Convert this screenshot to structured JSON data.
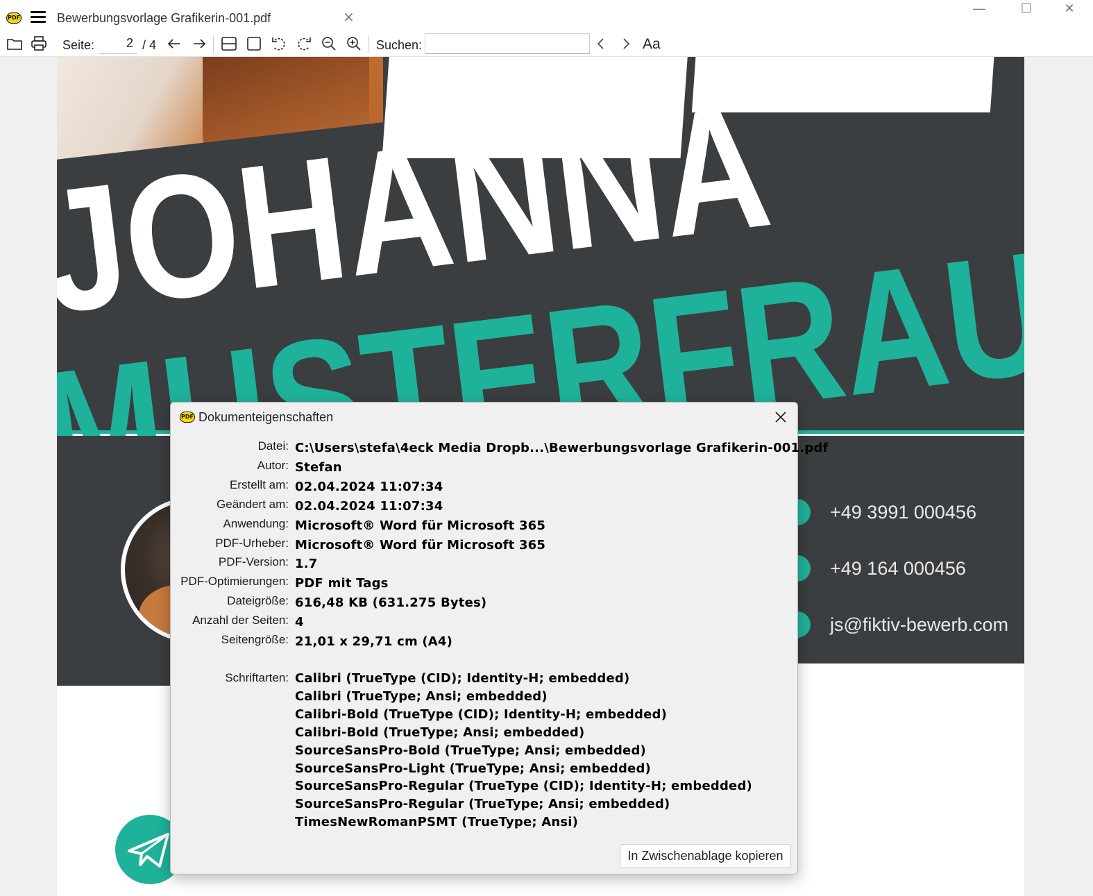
{
  "window": {
    "tab_title": "Bewerbungsvorlage Grafikerin-001.pdf",
    "app_icon_text": "PDF"
  },
  "toolbar": {
    "page_label": "Seite:",
    "page_current": "2",
    "page_total": "/ 4",
    "search_label": "Suchen:",
    "search_value": "",
    "case_label": "Aa"
  },
  "document": {
    "first_name": "JOHANNA",
    "last_name": "MUSTERFRAU",
    "phone_1": "+49 3991 000456",
    "phone_2": "+49 164 000456",
    "email": "js@fiktiv-bewerb.com",
    "colors": {
      "dark": "#3b3e40",
      "teal": "#1fb29a",
      "white": "#ffffff"
    }
  },
  "dialog": {
    "title": "Dokumenteigenschaften",
    "icon_text": "PDF",
    "properties": [
      {
        "label": "Datei:",
        "value": "C:\\Users\\stefa\\4eck Media Dropb...\\Bewerbungsvorlage Grafikerin-001.pdf"
      },
      {
        "label": "Autor:",
        "value": "Stefan"
      },
      {
        "label": "Erstellt am:",
        "value": "02.04.2024 11:07:34"
      },
      {
        "label": "Geändert am:",
        "value": "02.04.2024 11:07:34"
      },
      {
        "label": "Anwendung:",
        "value": "Microsoft® Word für Microsoft 365"
      },
      {
        "label": "PDF-Urheber:",
        "value": "Microsoft® Word für Microsoft 365"
      },
      {
        "label": "PDF-Version:",
        "value": "1.7"
      },
      {
        "label": "PDF-Optimierungen:",
        "value": "PDF mit Tags"
      },
      {
        "label": "Dateigröße:",
        "value": "616,48 KB (631.275 Bytes)"
      },
      {
        "label": "Anzahl der Seiten:",
        "value": "4"
      },
      {
        "label": "Seitengröße:",
        "value": "21,01 x 29,71 cm (A4)"
      }
    ],
    "fonts_label": "Schriftarten:",
    "fonts": [
      "Calibri (TrueType (CID); Identity-H; embedded)",
      "Calibri (TrueType; Ansi; embedded)",
      "Calibri-Bold (TrueType (CID); Identity-H; embedded)",
      "Calibri-Bold (TrueType; Ansi; embedded)",
      "SourceSansPro-Bold (TrueType; Ansi; embedded)",
      "SourceSansPro-Light (TrueType; Ansi; embedded)",
      "SourceSansPro-Regular (TrueType (CID); Identity-H; embedded)",
      "SourceSansPro-Regular (TrueType; Ansi; embedded)",
      "TimesNewRomanPSMT (TrueType; Ansi)"
    ],
    "copy_button": "In Zwischenablage kopieren"
  }
}
